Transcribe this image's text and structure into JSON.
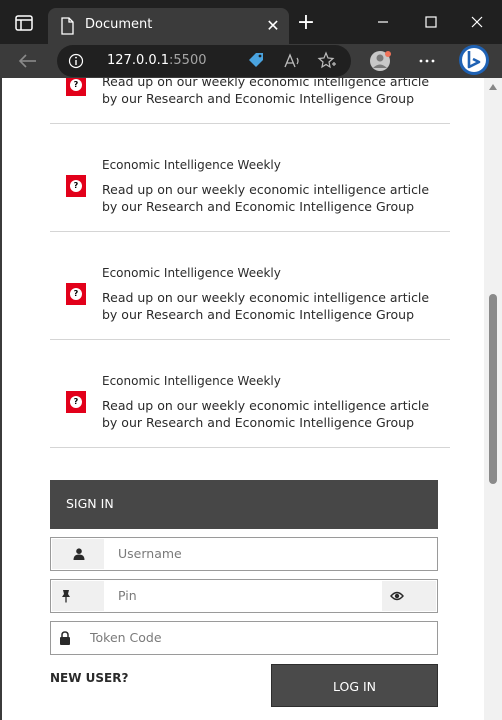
{
  "browser": {
    "tab_title": "Document",
    "tab_close": "✕",
    "new_tab": "+",
    "url_host": "127.0.0.1",
    "url_port": ":5500"
  },
  "news": {
    "partial_desc": "Read up on our weekly economic intelligence article by our Research and Economic Intelligence Group",
    "items": [
      {
        "title": "Economic Intelligence Weekly",
        "desc": "Read up on our weekly economic intelligence article by our Research and Economic Intelligence Group"
      },
      {
        "title": "Economic Intelligence Weekly",
        "desc": "Read up on our weekly economic intelligence article by our Research and Economic Intelligence Group"
      },
      {
        "title": "Economic Intelligence Weekly",
        "desc": "Read up on our weekly economic intelligence article by our Research and Economic Intelligence Group"
      }
    ]
  },
  "signin": {
    "header": "SIGN IN",
    "username_placeholder": "Username",
    "pin_placeholder": "Pin",
    "token_placeholder": "Token Code",
    "new_user": "NEW USER?",
    "login_label": "LOG IN"
  },
  "colors": {
    "accent_red": "#e2001a",
    "signin_header_bg": "#474747",
    "login_bg": "#4a4a4a"
  }
}
